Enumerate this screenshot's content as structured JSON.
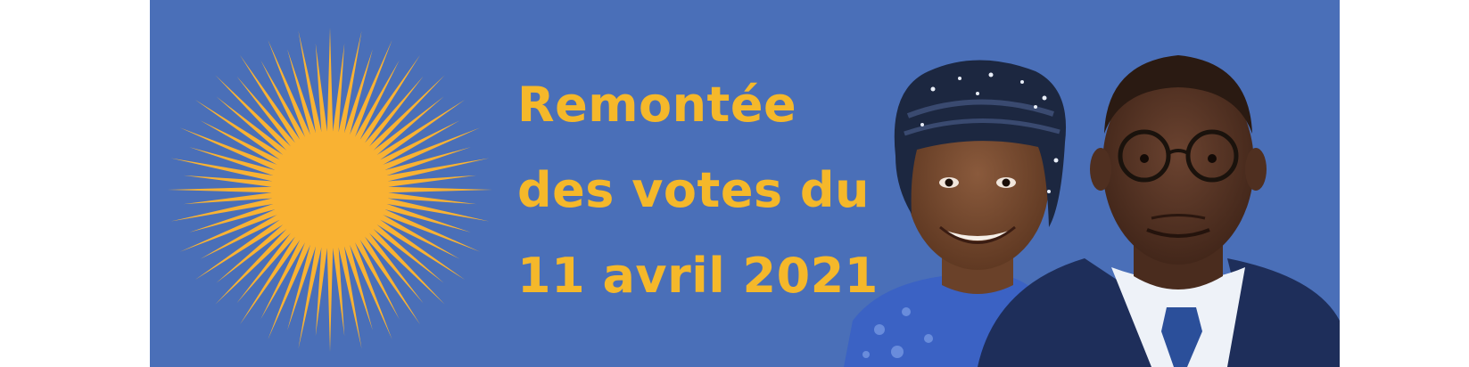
{
  "banner": {
    "headline_lines": [
      "Remontée",
      "des votes du",
      "11 avril 2021"
    ],
    "colors": {
      "background": "#4a6fb8",
      "text": "#f5b82a",
      "sun": "#f9b233"
    },
    "icons": {
      "sun": "sun-icon"
    }
  }
}
